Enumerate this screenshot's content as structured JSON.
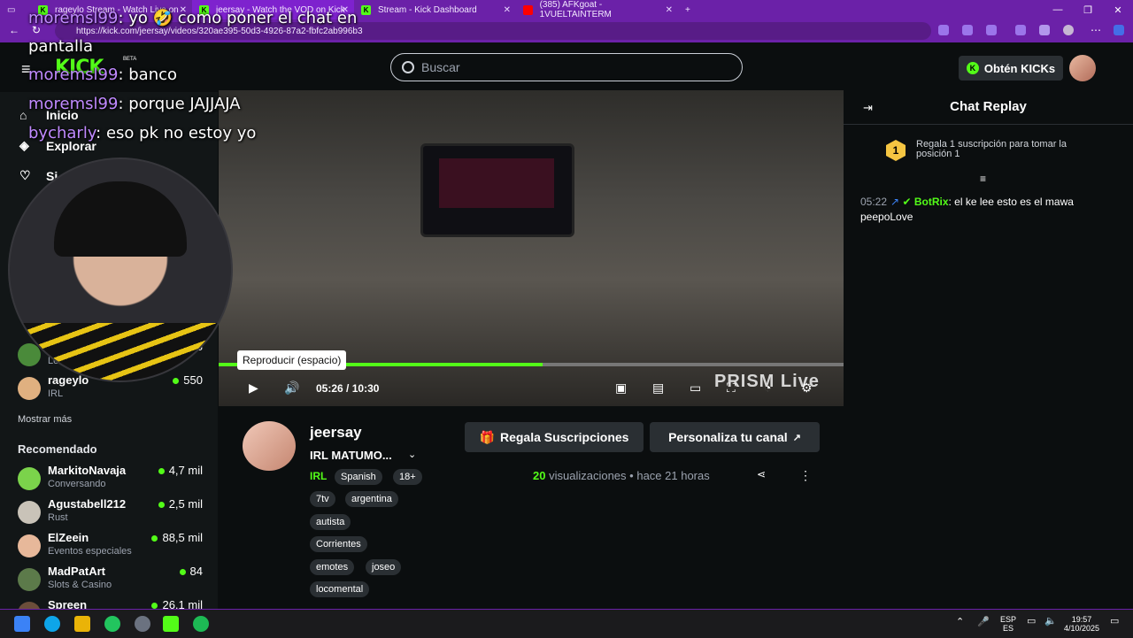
{
  "browser": {
    "tabs": [
      {
        "title": "rageylo Stream - Watch Live on",
        "icon": "kick-icon"
      },
      {
        "title": "jeersay - Watch the VOD on Kick",
        "icon": "kick-icon"
      },
      {
        "title": "Stream - Kick Dashboard",
        "icon": "kick-icon"
      },
      {
        "title": "(385) AFKgoat - 1VUELTAINTERM",
        "icon": "youtube-icon"
      }
    ],
    "url": "https://kick.com/jeersay/videos/320ae395-50d3-4926-87a2-fbfc2ab996b3"
  },
  "header": {
    "logo": "KICK",
    "beta": "BETA",
    "search_placeholder": "Buscar",
    "kicks_button": "Obtén KICKs"
  },
  "sidebar": {
    "nav": [
      {
        "label": "Inicio",
        "icon": "home-icon"
      },
      {
        "label": "Explorar",
        "icon": "compass-icon"
      },
      {
        "label": "Si",
        "icon": "heart-icon"
      }
    ],
    "following": [
      {
        "name": "rageylo",
        "sub": "IRL",
        "viewers": "550"
      }
    ],
    "partial_viewers": "8",
    "partial_sub": "Le",
    "show_more": "Mostrar más",
    "recommended_label": "Recomendado",
    "recommended": [
      {
        "name": "MarkitoNavaja",
        "sub": "Conversando",
        "viewers": "4,7 mil",
        "color": "#7bd34b"
      },
      {
        "name": "Agustabell212",
        "sub": "Rust",
        "viewers": "2,5 mil",
        "color": "#c9c3b8"
      },
      {
        "name": "ElZeein",
        "sub": "Eventos especiales",
        "viewers": "88,5 mil",
        "color": "#e7b89a"
      },
      {
        "name": "MadPatArt",
        "sub": "Slots & Casino",
        "viewers": "84",
        "color": "#5c7a4a"
      },
      {
        "name": "Spreen",
        "sub": "",
        "viewers": "26,1 mil",
        "color": "#6b4e3a"
      }
    ]
  },
  "player": {
    "tooltip": "Reproducir (espacio)",
    "current_time": "05:26",
    "separator": "/",
    "duration": "10:30",
    "progress": 0.518,
    "watermark": "PRISM Live"
  },
  "overlay_chat": [
    {
      "user": "moremsl99",
      "text": ": yo 🤣 como poner el chat en"
    },
    {
      "user": "",
      "text": "pantalla"
    },
    {
      "user": "moremsl99",
      "text": ": banco"
    },
    {
      "user": "moremsl99",
      "text": ": porque JAJJAJA"
    },
    {
      "user": "bycharly",
      "text": ": eso pk no estoy yo"
    }
  ],
  "chat": {
    "title": "Chat Replay",
    "gift_rank": "1",
    "gift_text": "Regala 1 suscripción para tomar la posición 1",
    "messages": [
      {
        "time": "05:22",
        "user": "BotRix",
        "text": ": el ke lee esto es el mawa peepoLove"
      }
    ]
  },
  "video_info": {
    "streamer": "jeersay",
    "title": "IRL MATUMO...",
    "category": "IRL",
    "tags": [
      "Spanish",
      "18+",
      "7tv",
      "argentina",
      "autista",
      "Corrientes",
      "emotes",
      "joseo",
      "locomental"
    ],
    "gift_button": "Regala Suscripciones",
    "customize_button": "Personaliza tu canal",
    "views_count": "20",
    "views_label": "visualizaciones",
    "bullet": "•",
    "ago": "hace 21 horas"
  },
  "taskbar": {
    "lang_top": "ESP",
    "lang_bottom": "ES",
    "time": "19:57",
    "date": "4/10/2025"
  },
  "colors": {
    "accent": "#53fc18",
    "browser": "#6b21a8",
    "bg": "#0b0e0f"
  }
}
